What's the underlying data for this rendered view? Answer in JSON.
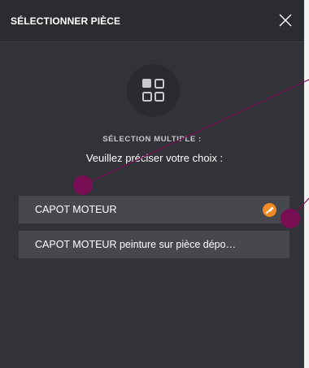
{
  "modal": {
    "title": "SÉLECTIONNER PIÈCE",
    "close_icon": "close-icon",
    "choice_icon": "grid-icon",
    "section_label": "SÉLECTION MULTIPLE :",
    "prompt": "Veuillez préciser votre choix :"
  },
  "options": [
    {
      "label": "CAPOT MOTEUR",
      "badge_icon": "paint-brush-icon",
      "badge_color": "#f08a24"
    },
    {
      "label": "CAPOT MOTEUR peinture sur pièce dépo…"
    }
  ],
  "colors": {
    "modal_bg": "#323338",
    "header_bg": "#2b2c30",
    "option_bg": "#47484e",
    "annotation": "#7a0e55"
  }
}
